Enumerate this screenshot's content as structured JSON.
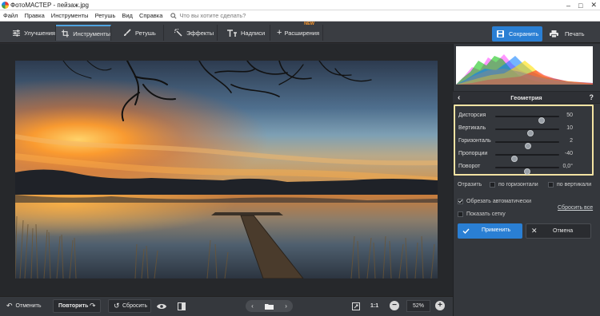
{
  "window": {
    "title": "ФотоМАСТЕР - пейзаж.jpg"
  },
  "menu": {
    "items": [
      "Файл",
      "Правка",
      "Инструменты",
      "Ретушь",
      "Вид",
      "Справка"
    ],
    "search_placeholder": "Что вы хотите сделать?"
  },
  "tabs": [
    {
      "label": "Улучшения",
      "icon": "sliders-icon"
    },
    {
      "label": "Инструменты",
      "icon": "crop-icon",
      "active": true
    },
    {
      "label": "Ретушь",
      "icon": "brush-icon"
    },
    {
      "label": "Эффекты",
      "icon": "magic-wand-icon"
    },
    {
      "label": "Надписи",
      "icon": "text-icon"
    },
    {
      "label": "Расширения",
      "icon": "plus-icon",
      "badge": "NEW"
    }
  ],
  "actions": {
    "save": "Сохранить",
    "print": "Печать"
  },
  "panel": {
    "title": "Геометрия",
    "help": "?",
    "sliders": [
      {
        "label": "Дисторсия",
        "value": "50",
        "level": 0.72
      },
      {
        "label": "Вертикаль",
        "value": "10",
        "level": 0.55
      },
      {
        "label": "Горизонталь",
        "value": "2",
        "level": 0.51
      },
      {
        "label": "Пропорции",
        "value": "-40",
        "level": 0.3
      },
      {
        "label": "Поворот",
        "value": "0,0°",
        "level": 0.5
      }
    ],
    "reflect_label": "Отразить",
    "reflect_horizontal": "по горизонтали",
    "reflect_vertical": "по вертикали",
    "auto_crop": "Обрезать автоматически",
    "reset_all": "Сбросить все",
    "show_grid": "Показать сетку",
    "apply": "Применить",
    "cancel": "Отмена"
  },
  "bottom": {
    "undo": "Отменить",
    "redo": "Повторить",
    "reset": "Сбросить",
    "ratio": "1:1",
    "zoom": "52%"
  },
  "colors": {
    "accent": "#2a7fd4",
    "highlight_frame": "#f3e3a3",
    "new_badge": "#ff9a2e"
  }
}
